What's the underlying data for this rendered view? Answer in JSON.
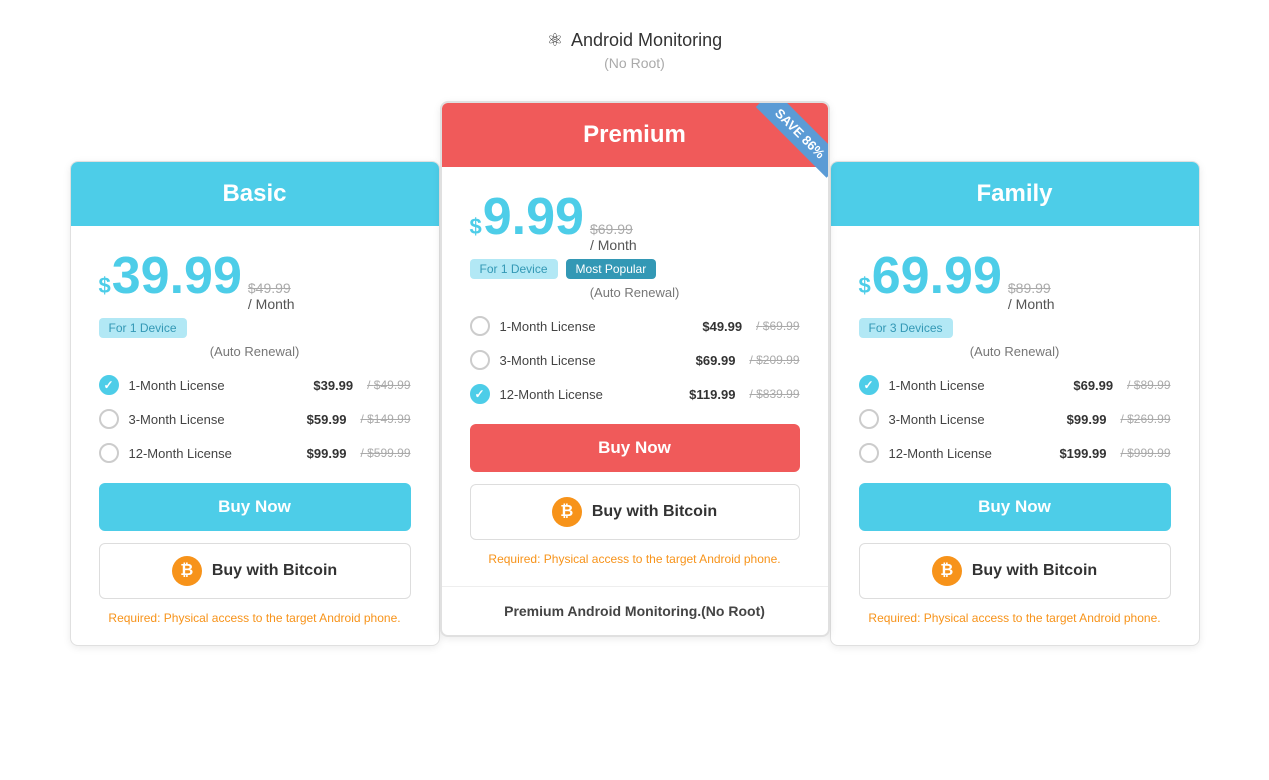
{
  "header": {
    "title": "Android Monitoring",
    "subtitle": "(No Root)"
  },
  "plans": [
    {
      "id": "basic",
      "name": "Basic",
      "header_style": "cyan",
      "currency": "$",
      "price": "39.99",
      "old_price": "$49.99",
      "per_month": "/ Month",
      "device_label": "For 1 Device",
      "show_popular": false,
      "auto_renewal": "(Auto Renewal)",
      "licenses": [
        {
          "label": "1-Month License",
          "price": "$39.99",
          "old": "$49.99",
          "checked": true
        },
        {
          "label": "3-Month License",
          "price": "$59.99",
          "old": "$149.99",
          "checked": false
        },
        {
          "label": "12-Month License",
          "price": "$99.99",
          "old": "$599.99",
          "checked": false
        }
      ],
      "buy_now_label": "Buy Now",
      "buy_now_style": "cyan",
      "bitcoin_label": "Buy with Bitcoin",
      "required_note": "Required: Physical access to the target Android phone.",
      "show_bottom": false,
      "bottom_text": ""
    },
    {
      "id": "premium",
      "name": "Premium",
      "header_style": "red",
      "currency": "$",
      "price": "9.99",
      "old_price": "$69.99",
      "per_month": "/ Month",
      "device_label": "For 1 Device",
      "show_popular": true,
      "popular_label": "Most Popular",
      "auto_renewal": "(Auto Renewal)",
      "ribbon_label": "SAVE 86%",
      "licenses": [
        {
          "label": "1-Month License",
          "price": "$49.99",
          "old": "$69.99",
          "checked": false
        },
        {
          "label": "3-Month License",
          "price": "$69.99",
          "old": "$209.99",
          "checked": false
        },
        {
          "label": "12-Month License",
          "price": "$119.99",
          "old": "$839.99",
          "checked": true
        }
      ],
      "buy_now_label": "Buy Now",
      "buy_now_style": "red",
      "bitcoin_label": "Buy with Bitcoin",
      "required_note": "Required: Physical access to the target Android phone.",
      "show_bottom": true,
      "bottom_text": "Premium Android Monitoring.(No Root)"
    },
    {
      "id": "family",
      "name": "Family",
      "header_style": "cyan",
      "currency": "$",
      "price": "69.99",
      "old_price": "$89.99",
      "per_month": "/ Month",
      "device_label": "For 3 Devices",
      "show_popular": false,
      "auto_renewal": "(Auto Renewal)",
      "licenses": [
        {
          "label": "1-Month License",
          "price": "$69.99",
          "old": "$89.99",
          "checked": true
        },
        {
          "label": "3-Month License",
          "price": "$99.99",
          "old": "$269.99",
          "checked": false
        },
        {
          "label": "12-Month License",
          "price": "$199.99",
          "old": "$999.99",
          "checked": false
        }
      ],
      "buy_now_label": "Buy Now",
      "buy_now_style": "cyan",
      "bitcoin_label": "Buy with Bitcoin",
      "required_note": "Required: Physical access to the target Android phone.",
      "show_bottom": false,
      "bottom_text": ""
    }
  ]
}
